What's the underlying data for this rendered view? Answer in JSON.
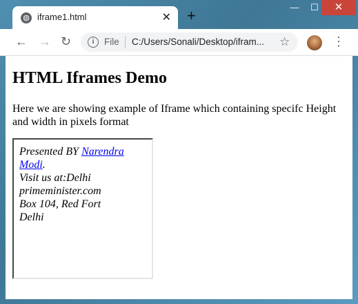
{
  "browser": {
    "tab_title": "iframe1.html",
    "tab_close": "✕",
    "new_tab": "+",
    "file_label": "File",
    "url": "C:/Users/Sonali/Desktop/ifram...",
    "controls": {
      "minimize": "—",
      "maximize": "☐",
      "close": "✕"
    }
  },
  "page": {
    "heading": "HTML Iframes Demo",
    "paragraph": "Here we are showing example of Iframe which containing specifc Height and width in pixels format",
    "iframe": {
      "presented_by": "Presented BY ",
      "link_text": "Narendra Modi",
      "after_link": ".",
      "visit": "Visit us at:Delhi",
      "site": "primeminister.com",
      "box": "Box 104, Red Fort",
      "city": "Delhi"
    }
  },
  "colors": {
    "close_button": "#c9453a",
    "link": "#0000ee"
  }
}
